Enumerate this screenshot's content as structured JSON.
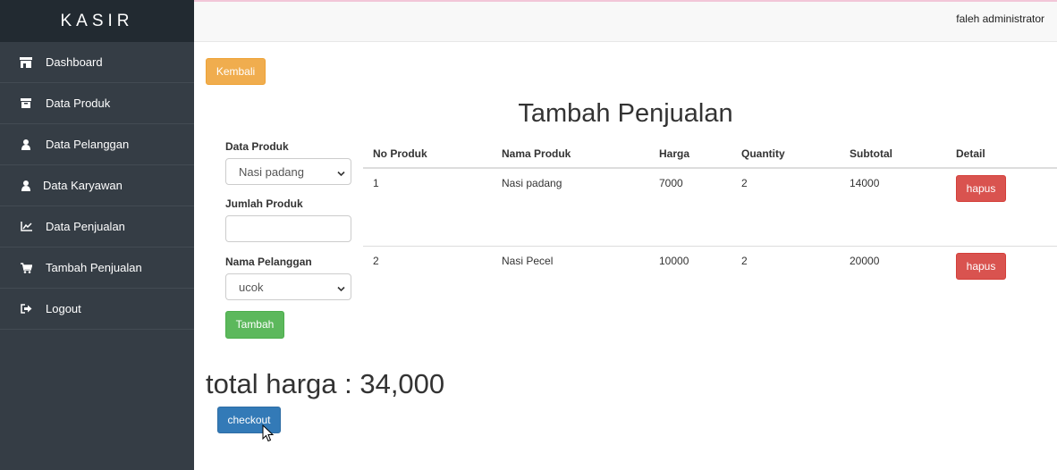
{
  "sidebar": {
    "brand": "KASIR",
    "items": [
      {
        "label": "Dashboard",
        "icon": "store-icon"
      },
      {
        "label": "Data Produk",
        "icon": "archive-icon"
      },
      {
        "label": "Data Pelanggan",
        "icon": "user-icon"
      },
      {
        "label": "Data Karyawan",
        "icon": "user-icon"
      },
      {
        "label": "Data Penjualan",
        "icon": "line-chart-icon"
      },
      {
        "label": "Tambah Penjualan",
        "icon": "cart-icon"
      },
      {
        "label": "Logout",
        "icon": "logout-icon"
      }
    ]
  },
  "topbar": {
    "user": "faleh administrator"
  },
  "main": {
    "back_label": "Kembali",
    "title": "Tambah Penjualan",
    "form": {
      "produk_label": "Data Produk",
      "produk_value": "Nasi padang",
      "jumlah_label": "Jumlah Produk",
      "jumlah_value": "",
      "pelanggan_label": "Nama Pelanggan",
      "pelanggan_value": "ucok",
      "submit_label": "Tambah"
    },
    "table": {
      "headers": [
        "No Produk",
        "Nama Produk",
        "Harga",
        "Quantity",
        "Subtotal",
        "Detail"
      ],
      "rows": [
        {
          "no": "1",
          "nama": "Nasi padang",
          "harga": "7000",
          "qty": "2",
          "subtotal": "14000",
          "action": "hapus"
        },
        {
          "no": "2",
          "nama": "Nasi Pecel",
          "harga": "10000",
          "qty": "2",
          "subtotal": "20000",
          "action": "hapus"
        }
      ]
    },
    "total": "total harga : 34,000",
    "checkout_label": "checkout"
  },
  "colors": {
    "sidebar_bg": "#353d45",
    "brand_bg": "#222a31",
    "warning": "#f0ad4e",
    "success": "#5cb85c",
    "danger": "#d9534f",
    "primary": "#337ab7"
  }
}
